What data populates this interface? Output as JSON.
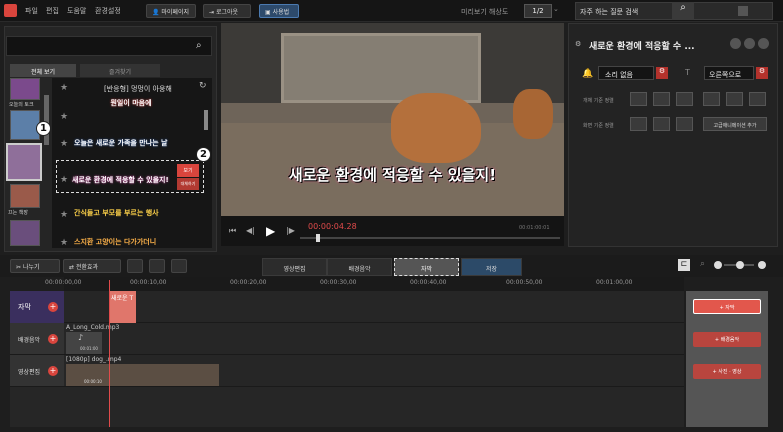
{
  "menu": [
    "파일",
    "편집",
    "도움말",
    "환경설정"
  ],
  "toolbar": {
    "mypage": "마이페이지",
    "logout": "로그아웃",
    "user": "사용법"
  },
  "preview": {
    "res_label": "미리보기 해상도",
    "res_value": "1/2"
  },
  "faq": {
    "placeholder": "자주 하는 질문 검색"
  },
  "left": {
    "tab_all": "전체 보기",
    "tab_fav": "즐겨찾기",
    "head": "[반응형] 멍멍이 아웅해",
    "side_labels": [
      "오늘의 토크",
      "",
      "",
      "끄는 책장",
      "",
      ""
    ],
    "items": [
      "뭔일이 마음에",
      "오늘은 새로운 가족을 만나는 날",
      "새로운 환경에 적응할 수 있을지!",
      "간식들고 부모를 부르는 행사",
      "스지환 고양이는 다가가더니"
    ],
    "view_btn": "보기",
    "rename_btn": "대체하기"
  },
  "video": {
    "subtitle": "새로운 환경에 적응할 수 있을지!",
    "time": "00:00:04.28",
    "end": "00:01:00:01"
  },
  "right": {
    "title": "새로운 환경에 적응할 수 ...",
    "sound": "소리 없음",
    "dir": "오른쪽으로",
    "row1": "개체 기준 정렬",
    "row2": "화면 기준 정렬",
    "adv": "고급애니메이션 추가"
  },
  "mid": {
    "split": "나누기",
    "transition": "전환효과",
    "tabs": [
      "영상편집",
      "배경음악",
      "자막",
      "저장"
    ]
  },
  "ruler": [
    "00:00:00,00",
    "00:00:10,00",
    "00:00:20,00",
    "00:00:30,00",
    "00:00:40,00",
    "00:00:50,00",
    "00:01:00,00"
  ],
  "tracks": {
    "sub": "자막",
    "bgm": "배경음악",
    "vid": "영상편집"
  },
  "clips": {
    "sub": "새로운 T",
    "bgm": "A_Long_Cold.mp3",
    "bgm_len": "00:01:00",
    "vid": "[1080p] dog_.mp4",
    "vid_len": "00:00:10"
  },
  "add": {
    "sub": "자막",
    "bgm": "배경음악",
    "vid": "사진 · 영상"
  },
  "badges": [
    "1",
    "2"
  ]
}
